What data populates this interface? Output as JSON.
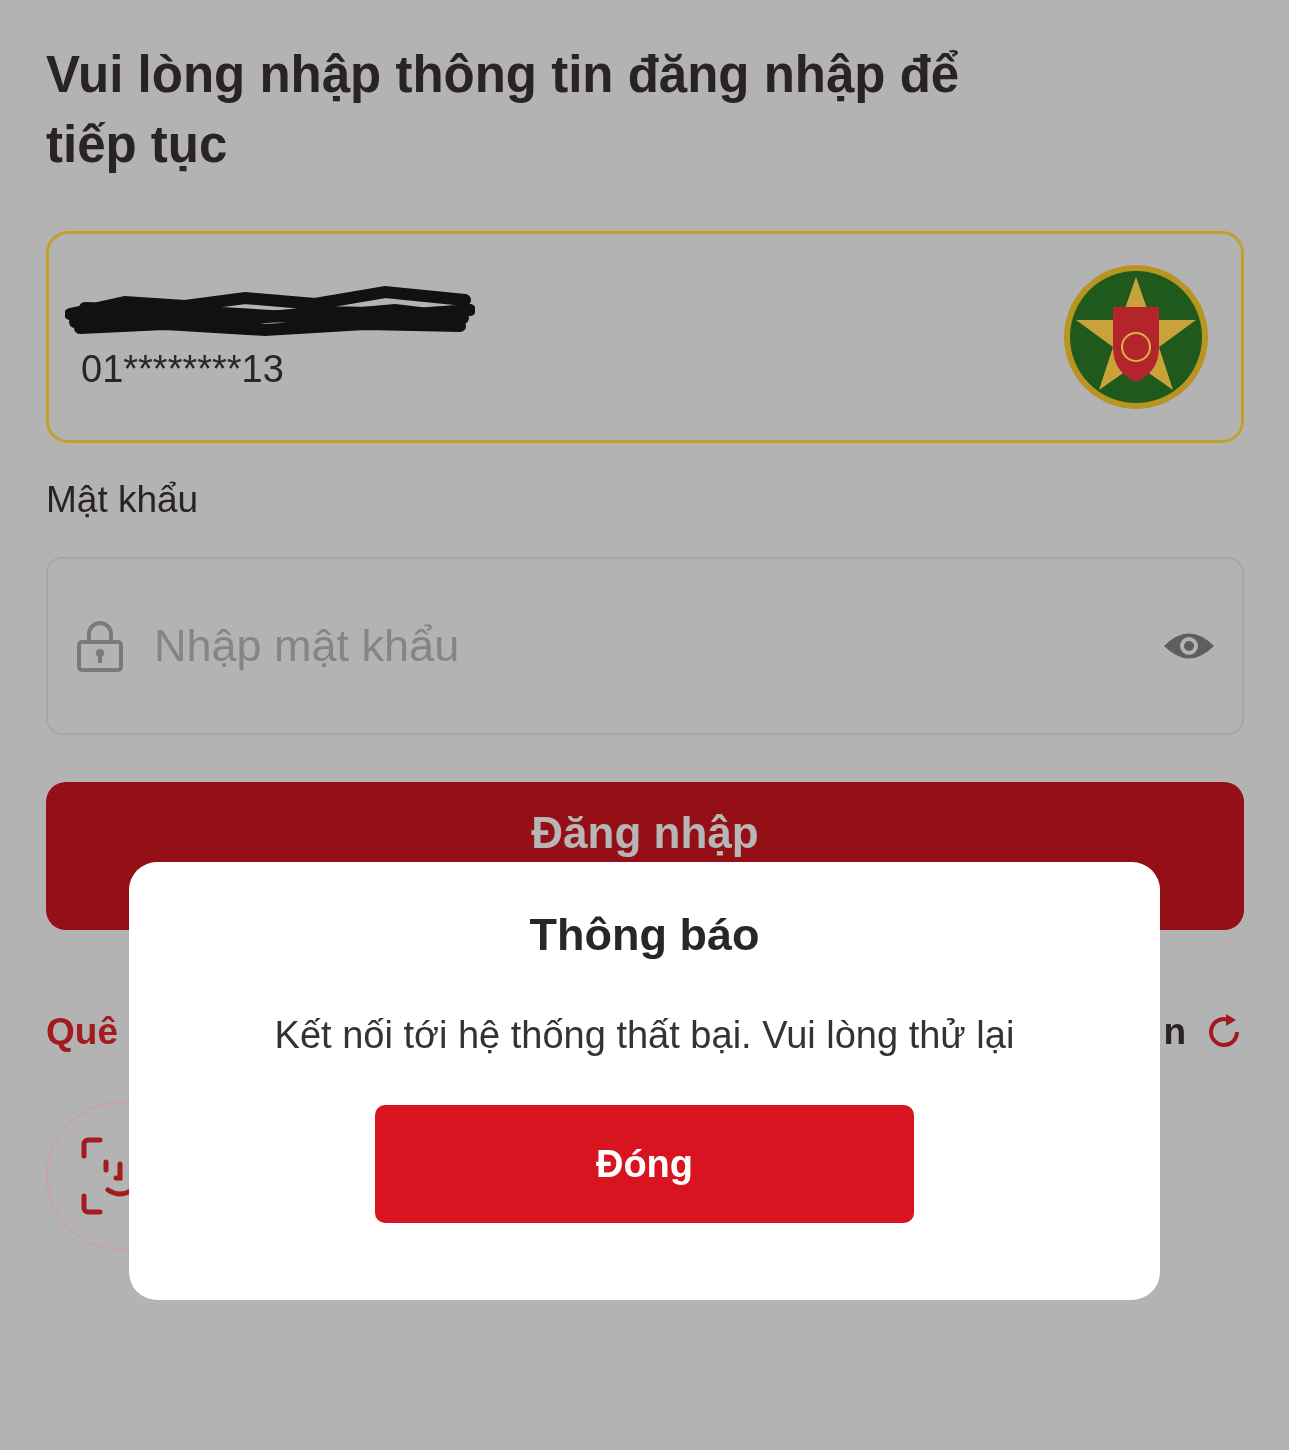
{
  "heading": "Vui lòng nhập thông tin đăng nhập để tiếp tục",
  "account": {
    "number": "01********13"
  },
  "password": {
    "label": "Mật khẩu",
    "placeholder": "Nhập mật khẩu"
  },
  "login_button": "Đăng nhập",
  "links": {
    "forgot": "Quê",
    "right": "n"
  },
  "dialog": {
    "title": "Thông báo",
    "message": "Kết nối tới hệ thống thất bại. Vui lòng thử lại",
    "button": "Đóng"
  }
}
